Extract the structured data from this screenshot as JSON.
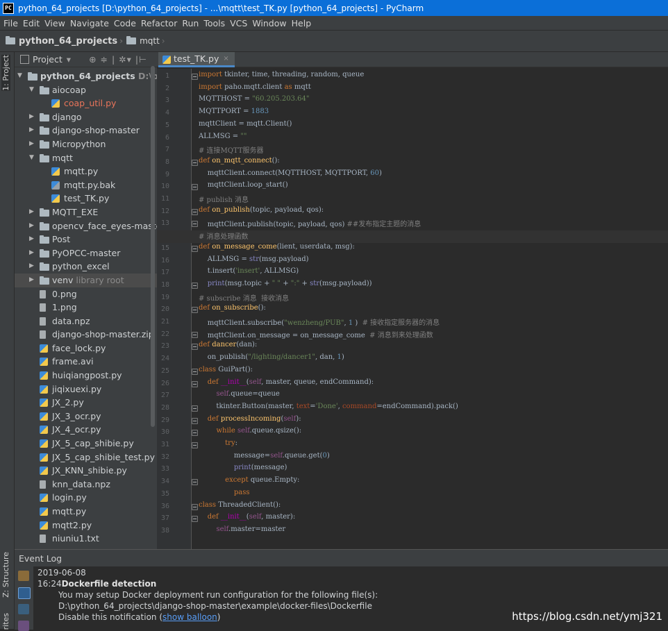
{
  "window": {
    "title": "python_64_projects [D:\\python_64_projects] - ...\\mqtt\\test_TK.py [python_64_projects] - PyCharm",
    "logo": "PC"
  },
  "menu": [
    "File",
    "Edit",
    "View",
    "Navigate",
    "Code",
    "Refactor",
    "Run",
    "Tools",
    "VCS",
    "Window",
    "Help"
  ],
  "breadcrumb": {
    "project": "python_64_projects",
    "folder": "mqtt"
  },
  "sidebar_tabs": {
    "project": "1: Project",
    "structure": "Z: Structure",
    "favorites": "rites"
  },
  "project_panel": {
    "title": "Project",
    "dropdown_arrow": "▾",
    "tools": "⊕ ≑ | ✲▾ |⊢"
  },
  "tree": [
    {
      "label": "python_64_projects",
      "hint": "D:\\pythor",
      "level": 0,
      "type": "folder",
      "expanded": true,
      "bold": true
    },
    {
      "label": "aiocoap",
      "level": 1,
      "type": "folder",
      "expanded": true
    },
    {
      "label": "coap_util.py",
      "level": 2,
      "type": "py",
      "red": true
    },
    {
      "label": "django",
      "level": 1,
      "type": "folder"
    },
    {
      "label": "django-shop-master",
      "level": 1,
      "type": "folder"
    },
    {
      "label": "Micropython",
      "level": 1,
      "type": "folder"
    },
    {
      "label": "mqtt",
      "level": 1,
      "type": "folder",
      "expanded": true
    },
    {
      "label": "mqtt.py",
      "level": 2,
      "type": "py"
    },
    {
      "label": "mqtt.py.bak",
      "level": 2,
      "type": "bak"
    },
    {
      "label": "test_TK.py",
      "level": 2,
      "type": "py"
    },
    {
      "label": "MQTT_EXE",
      "level": 1,
      "type": "folder"
    },
    {
      "label": "opencv_face_eyes-master",
      "level": 1,
      "type": "folder"
    },
    {
      "label": "Post",
      "level": 1,
      "type": "folder"
    },
    {
      "label": "PyOPCC-master",
      "level": 1,
      "type": "folder"
    },
    {
      "label": "python_excel",
      "level": 1,
      "type": "folder"
    },
    {
      "label": "venv",
      "hint": "library root",
      "level": 1,
      "type": "folder",
      "selected": true
    },
    {
      "label": "0.png",
      "level": 1,
      "type": "file"
    },
    {
      "label": "1.png",
      "level": 1,
      "type": "file"
    },
    {
      "label": "data.npz",
      "level": 1,
      "type": "file"
    },
    {
      "label": "django-shop-master.zip",
      "level": 1,
      "type": "file"
    },
    {
      "label": "face_lock.py",
      "level": 1,
      "type": "py"
    },
    {
      "label": "frame.avi",
      "level": 1,
      "type": "py"
    },
    {
      "label": "huiqiangpost.py",
      "level": 1,
      "type": "py"
    },
    {
      "label": "jiqixuexi.py",
      "level": 1,
      "type": "py"
    },
    {
      "label": "JX_2.py",
      "level": 1,
      "type": "py"
    },
    {
      "label": "JX_3_ocr.py",
      "level": 1,
      "type": "py"
    },
    {
      "label": "JX_4_ocr.py",
      "level": 1,
      "type": "py"
    },
    {
      "label": "JX_5_cap_shibie.py",
      "level": 1,
      "type": "py"
    },
    {
      "label": "JX_5_cap_shibie_test.py",
      "level": 1,
      "type": "py"
    },
    {
      "label": "JX_KNN_shibie.py",
      "level": 1,
      "type": "py"
    },
    {
      "label": "knn_data.npz",
      "level": 1,
      "type": "file"
    },
    {
      "label": "login.py",
      "level": 1,
      "type": "py"
    },
    {
      "label": "mqtt.py",
      "level": 1,
      "type": "py"
    },
    {
      "label": "mqtt2.py",
      "level": 1,
      "type": "py"
    },
    {
      "label": "niuniu1.txt",
      "level": 1,
      "type": "file"
    }
  ],
  "editor": {
    "tab": "test_TK.py",
    "tab_close": "×",
    "highlight_line": 14,
    "lines": [
      [
        [
          "k",
          "import "
        ],
        [
          "",
          "tkinter, time, threading, random, queue"
        ]
      ],
      [
        [
          "k",
          "import "
        ],
        [
          "",
          "paho.mqtt.client "
        ],
        [
          "k",
          "as "
        ],
        [
          "",
          "mqtt"
        ]
      ],
      [
        [
          "",
          "MQTTHOST = "
        ],
        [
          "s",
          "\"60.205.203.64\""
        ]
      ],
      [
        [
          "",
          "MQTTPORT = "
        ],
        [
          "n",
          "1883"
        ]
      ],
      [
        [
          "",
          "mqttClient = mqtt.Client()"
        ]
      ],
      [
        [
          "",
          "ALLMSG = "
        ],
        [
          "s",
          "\"\""
        ]
      ],
      [
        [
          "c",
          "# 连接MQTT服务器"
        ]
      ],
      [
        [
          "k",
          "def "
        ],
        [
          "f",
          "on_mqtt_connect"
        ],
        [
          "",
          "():"
        ]
      ],
      [
        [
          "",
          "    mqttClient.connect(MQTTHOST, MQTTPORT, "
        ],
        [
          "n",
          "60"
        ],
        [
          "",
          ")"
        ]
      ],
      [
        [
          "",
          "    mqttClient.loop_start()"
        ]
      ],
      [
        [
          "c",
          "# publish 消息"
        ]
      ],
      [
        [
          "k",
          "def "
        ],
        [
          "f",
          "on_publish"
        ],
        [
          "",
          "(topic, payload, qos):"
        ]
      ],
      [
        [
          "",
          "    mqttClient.publish(topic, payload, qos) "
        ],
        [
          "c",
          "##发布指定主题的消息"
        ]
      ],
      [
        [
          "c",
          "# 消息处理函数"
        ]
      ],
      [
        [
          "k",
          "def "
        ],
        [
          "f",
          "on_message_come"
        ],
        [
          "",
          "(lient, userdata, msg):"
        ]
      ],
      [
        [
          "",
          "    ALLMSG = "
        ],
        [
          "b",
          "str"
        ],
        [
          "",
          "(msg.payload)"
        ]
      ],
      [
        [
          "",
          "    t.insert("
        ],
        [
          "s",
          "'insert'"
        ],
        [
          "",
          ", ALLMSG)"
        ]
      ],
      [
        [
          "",
          "    "
        ],
        [
          "b",
          "print"
        ],
        [
          "",
          "(msg.topic + "
        ],
        [
          "s",
          "\" \""
        ],
        [
          "",
          " + "
        ],
        [
          "s",
          "\":\""
        ],
        [
          "",
          " + "
        ],
        [
          "b",
          "str"
        ],
        [
          "",
          "(msg.payload))"
        ]
      ],
      [
        [
          "c",
          "# subscribe 消息  接收消息"
        ]
      ],
      [
        [
          "k",
          "def "
        ],
        [
          "f",
          "on_subscribe"
        ],
        [
          "",
          "():"
        ]
      ],
      [
        [
          "",
          "    mqttClient.subscribe("
        ],
        [
          "s",
          "\"wenzheng/PUB\""
        ],
        [
          "",
          ", "
        ],
        [
          "n",
          "1"
        ],
        [
          "",
          " )  "
        ],
        [
          "c",
          "# 接收指定服务器的消息"
        ]
      ],
      [
        [
          "",
          "    mqttClient.on_message = on_message_come  "
        ],
        [
          "c",
          "# 消息到来处理函数"
        ]
      ],
      [
        [
          "k",
          "def "
        ],
        [
          "f",
          "dancer"
        ],
        [
          "",
          "(dan):"
        ]
      ],
      [
        [
          "",
          "    on_publish("
        ],
        [
          "s",
          "\"/lighting/dancer1\""
        ],
        [
          "",
          ", dan, "
        ],
        [
          "n",
          "1"
        ],
        [
          "",
          ")"
        ]
      ],
      [
        [
          "k",
          "class "
        ],
        [
          "",
          "GuiPart():"
        ]
      ],
      [
        [
          "",
          "    "
        ],
        [
          "k",
          "def "
        ],
        [
          "m",
          "__init__"
        ],
        [
          "",
          "("
        ],
        [
          "sf",
          "self"
        ],
        [
          "",
          ", master, queue, endCommand):"
        ]
      ],
      [
        [
          "",
          "        "
        ],
        [
          "sf",
          "self"
        ],
        [
          "",
          ".queue=queue"
        ]
      ],
      [
        [
          "",
          "        tkinter.Button(master, "
        ],
        [
          "p",
          "text"
        ],
        [
          "",
          "="
        ],
        [
          "s",
          "'Done'"
        ],
        [
          "",
          ", "
        ],
        [
          "p",
          "command"
        ],
        [
          "",
          "=endCommand).pack()"
        ]
      ],
      [
        [
          "",
          "    "
        ],
        [
          "k",
          "def "
        ],
        [
          "f",
          "processIncoming"
        ],
        [
          "",
          "("
        ],
        [
          "sf",
          "self"
        ],
        [
          "",
          "):"
        ]
      ],
      [
        [
          "",
          "        "
        ],
        [
          "k",
          "while "
        ],
        [
          "sf",
          "self"
        ],
        [
          "",
          ".queue.qsize():"
        ]
      ],
      [
        [
          "",
          "            "
        ],
        [
          "k",
          "try"
        ],
        [
          "",
          ":"
        ]
      ],
      [
        [
          "",
          "                message="
        ],
        [
          "sf",
          "self"
        ],
        [
          "",
          ".queue.get("
        ],
        [
          "n",
          "0"
        ],
        [
          "",
          ")"
        ]
      ],
      [
        [
          "",
          "                "
        ],
        [
          "b",
          "print"
        ],
        [
          "",
          "(message)"
        ]
      ],
      [
        [
          "",
          "            "
        ],
        [
          "k",
          "except "
        ],
        [
          "",
          "queue.Empty:"
        ]
      ],
      [
        [
          "",
          "                "
        ],
        [
          "k",
          "pass"
        ]
      ],
      [
        [
          "k",
          "class "
        ],
        [
          "",
          "ThreadedClient():"
        ]
      ],
      [
        [
          "",
          "    "
        ],
        [
          "k",
          "def "
        ],
        [
          "m",
          "__init__"
        ],
        [
          "",
          "("
        ],
        [
          "sf",
          "self"
        ],
        [
          "",
          ", master):"
        ]
      ],
      [
        [
          "",
          "        "
        ],
        [
          "sf",
          "self"
        ],
        [
          "",
          ".master=master"
        ]
      ]
    ],
    "fold_lines": [
      1,
      8,
      10,
      12,
      13,
      15,
      18,
      20,
      22,
      23,
      25,
      26,
      28,
      29,
      30,
      31,
      34,
      36,
      37
    ]
  },
  "event_log": {
    "title": "Event Log",
    "date": "2019-06-08",
    "time": "16:24",
    "headline": "Dockerfile detection",
    "line1": "You may setup Docker deployment run configuration for the following file(s):",
    "line2": "D:\\python_64_projects\\django-shop-master\\example\\docker-files\\Dockerfile",
    "line3": "Disable this notification (",
    "link": "show balloon",
    "line3_end": ")"
  },
  "watermark": "https://blog.csdn.net/ymj321"
}
